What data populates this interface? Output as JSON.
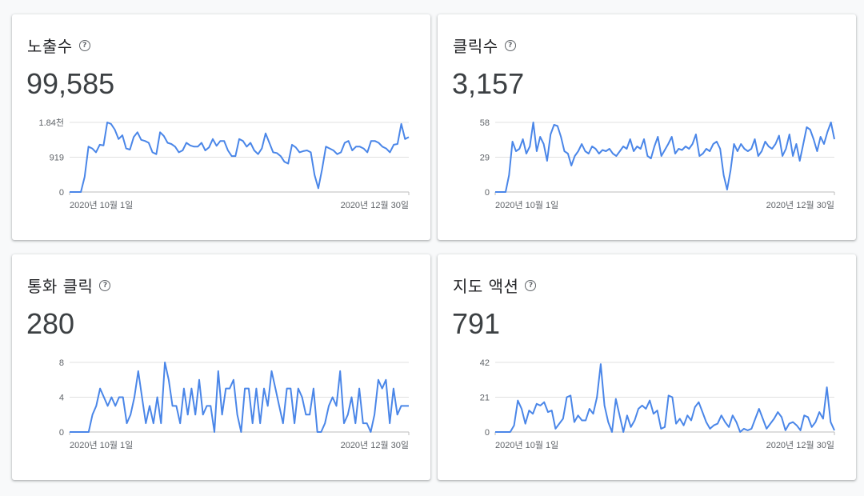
{
  "colors": {
    "line": "#4a86e8",
    "grid": "#e0e0e0"
  },
  "help_icon": "help-circle-icon",
  "cards": [
    {
      "title": "노출수",
      "value": "99,585"
    },
    {
      "title": "클릭수",
      "value": "3,157"
    },
    {
      "title": "통화 클릭",
      "value": "280"
    },
    {
      "title": "지도 액션",
      "value": "791"
    }
  ],
  "chart_data": [
    {
      "type": "line",
      "ytick_labels": [
        "1.84천",
        "919",
        "0"
      ],
      "yticks": [
        1840,
        919,
        0
      ],
      "ylim": [
        0,
        1840
      ],
      "xtick_labels": [
        "2020년 10월 1일",
        "2020년 12월 30일"
      ],
      "series": [
        {
          "values": [
            0,
            0,
            0,
            0,
            400,
            1200,
            1150,
            1050,
            1250,
            1230,
            1840,
            1800,
            1650,
            1400,
            1500,
            1150,
            1120,
            1450,
            1580,
            1380,
            1350,
            1300,
            1050,
            1000,
            1580,
            1480,
            1300,
            1270,
            1200,
            1050,
            1100,
            1300,
            1230,
            1200,
            1200,
            1300,
            1100,
            1180,
            1400,
            1220,
            1350,
            1350,
            1100,
            950,
            950,
            1400,
            1350,
            1200,
            1300,
            1100,
            1000,
            1150,
            1550,
            1300,
            1050,
            1030,
            950,
            800,
            750,
            1250,
            1180,
            1050,
            1080,
            1100,
            1050,
            450,
            100,
            600,
            1200,
            1150,
            1100,
            1000,
            1050,
            1300,
            1350,
            1100,
            1200,
            1200,
            1150,
            1050,
            1350,
            1350,
            1300,
            1200,
            1150,
            1050,
            1250,
            1270,
            1800,
            1400,
            1450
          ]
        }
      ]
    },
    {
      "type": "line",
      "ytick_labels": [
        "58",
        "29",
        "0"
      ],
      "yticks": [
        58,
        29,
        0
      ],
      "ylim": [
        0,
        58
      ],
      "xtick_labels": [
        "2020년 10월 1일",
        "2020년 12월 30일"
      ],
      "series": [
        {
          "values": [
            0,
            0,
            0,
            0,
            14,
            42,
            34,
            36,
            44,
            32,
            38,
            58,
            34,
            46,
            40,
            26,
            48,
            56,
            55,
            46,
            34,
            32,
            22,
            30,
            34,
            40,
            34,
            32,
            38,
            36,
            32,
            35,
            34,
            36,
            32,
            30,
            34,
            38,
            36,
            44,
            34,
            38,
            36,
            44,
            30,
            28,
            38,
            46,
            30,
            35,
            40,
            46,
            32,
            36,
            35,
            38,
            36,
            40,
            48,
            30,
            32,
            36,
            34,
            40,
            42,
            36,
            14,
            2,
            18,
            40,
            34,
            40,
            36,
            34,
            36,
            44,
            30,
            34,
            42,
            38,
            36,
            40,
            47,
            30,
            36,
            48,
            30,
            40,
            26,
            40,
            54,
            52,
            44,
            34,
            46,
            40,
            50,
            58,
            44
          ]
        }
      ]
    },
    {
      "type": "line",
      "ytick_labels": [
        "8",
        "4",
        "0"
      ],
      "yticks": [
        8,
        4,
        0
      ],
      "ylim": [
        0,
        8
      ],
      "xtick_labels": [
        "2020년 10월 1일",
        "2020년 12월 30일"
      ],
      "series": [
        {
          "values": [
            0,
            0,
            0,
            0,
            0,
            0,
            2,
            3,
            5,
            4,
            3,
            4,
            3,
            4,
            4,
            1,
            2,
            4,
            7,
            4,
            1,
            3,
            1,
            4,
            1,
            8,
            6,
            3,
            3,
            1,
            5,
            2,
            5,
            2,
            6,
            2,
            3,
            3,
            0,
            7,
            2,
            5,
            5,
            6,
            2,
            0,
            5,
            5,
            1,
            5,
            1,
            5,
            3,
            7,
            5,
            3,
            1,
            5,
            5,
            1,
            5,
            4,
            2,
            2,
            5,
            0,
            0,
            1,
            3,
            4,
            3,
            7,
            1,
            2,
            4,
            1,
            5,
            1,
            1,
            0,
            2,
            6,
            5,
            6,
            1,
            5,
            2,
            3,
            3,
            3
          ]
        }
      ]
    },
    {
      "type": "line",
      "ytick_labels": [
        "42",
        "21",
        "0"
      ],
      "yticks": [
        42,
        21,
        0
      ],
      "ylim": [
        0,
        42
      ],
      "xtick_labels": [
        "2020년 10월 1일",
        "2020년 12월 30일"
      ],
      "series": [
        {
          "values": [
            0,
            0,
            0,
            0,
            0,
            4,
            19,
            14,
            5,
            13,
            11,
            17,
            16,
            18,
            12,
            13,
            2,
            5,
            8,
            21,
            22,
            6,
            10,
            7,
            7,
            14,
            11,
            21,
            41,
            16,
            6,
            0,
            20,
            10,
            0,
            10,
            3,
            7,
            14,
            16,
            14,
            19,
            11,
            13,
            2,
            3,
            22,
            21,
            5,
            8,
            4,
            10,
            7,
            15,
            18,
            12,
            6,
            2,
            4,
            5,
            10,
            6,
            3,
            10,
            6,
            0,
            2,
            1,
            2,
            8,
            14,
            8,
            2,
            5,
            8,
            12,
            9,
            1,
            5,
            6,
            4,
            1,
            10,
            9,
            3,
            6,
            12,
            8,
            27,
            6,
            1
          ]
        }
      ]
    }
  ]
}
